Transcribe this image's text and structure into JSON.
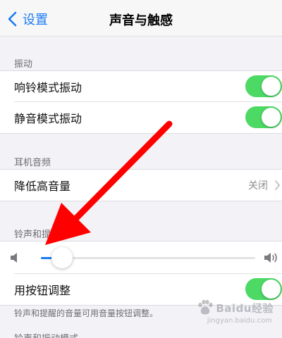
{
  "nav": {
    "back_label": "设置",
    "title": "声音与触感"
  },
  "sections": {
    "vibration": {
      "header": "振动",
      "rows": [
        {
          "label": "响铃模式振动",
          "toggle": true
        },
        {
          "label": "静音模式振动",
          "toggle": true
        }
      ]
    },
    "headphone": {
      "header": "耳机音频",
      "rows": [
        {
          "label": "降低高音量",
          "value": "关闭"
        }
      ]
    },
    "ringer": {
      "header": "铃声和提醒",
      "volume_level": 0.1,
      "button_row": {
        "label": "用按钮调整",
        "toggle": true
      },
      "footer": "铃声和提醒的音量可用音量按钮调整。"
    },
    "next": {
      "header": "铃声和振动模式"
    }
  },
  "watermark": {
    "text": "Baidu经验",
    "sub": "jingyan.baidu.com"
  },
  "colors": {
    "accent": "#1a7cf5",
    "toggle_on": "#4cd964",
    "arrow": "#ff0000"
  }
}
